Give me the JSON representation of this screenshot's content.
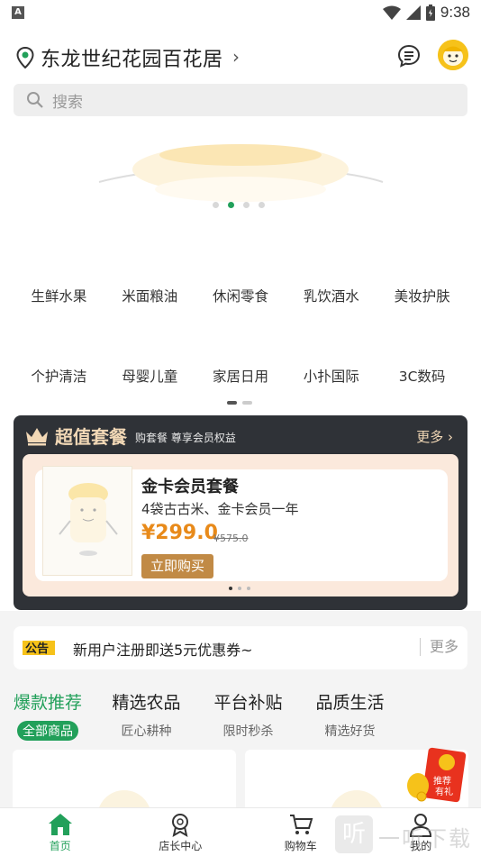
{
  "status_bar": {
    "indicator": "A",
    "time": "9:38"
  },
  "header": {
    "location": "东龙世纪花园百花居",
    "chevron": "›"
  },
  "search": {
    "placeholder": "搜索"
  },
  "categories": {
    "row1": [
      "生鲜水果",
      "米面粮油",
      "休闲零食",
      "乳饮酒水",
      "美妆护肤"
    ],
    "row2": [
      "个护清洁",
      "母婴儿童",
      "家居日用",
      "小扑国际",
      "3C数码"
    ]
  },
  "package": {
    "title": "超值套餐",
    "subtitle": "购套餐 尊享会员权益",
    "more": "更多 ›",
    "card": {
      "name": "金卡会员套餐",
      "desc": "4袋古古米、金卡会员一年",
      "price": "¥299.0",
      "original_price": "¥575.0",
      "buy_label": "立即购买"
    }
  },
  "notice": {
    "badge": "公告",
    "text": "新用户注册即送5元优惠券~",
    "more": "更多"
  },
  "tabs": [
    {
      "title": "爆款推荐",
      "sub": "全部商品"
    },
    {
      "title": "精选农品",
      "sub": "匠心耕种"
    },
    {
      "title": "平台补贴",
      "sub": "限时秒杀"
    },
    {
      "title": "品质生活",
      "sub": "精选好货"
    }
  ],
  "promo": {
    "line1": "推荐",
    "line2": "有礼"
  },
  "bottom_nav": [
    {
      "label": "首页"
    },
    {
      "label": "店长中心"
    },
    {
      "label": "购物车"
    },
    {
      "label": "我的"
    }
  ],
  "watermark": {
    "glyph": "听",
    "text": "一听下载"
  },
  "colors": {
    "accent": "#22a05a",
    "price": "#e88a1a",
    "gold": "#c18a45",
    "dark_panel": "#2f3237"
  }
}
